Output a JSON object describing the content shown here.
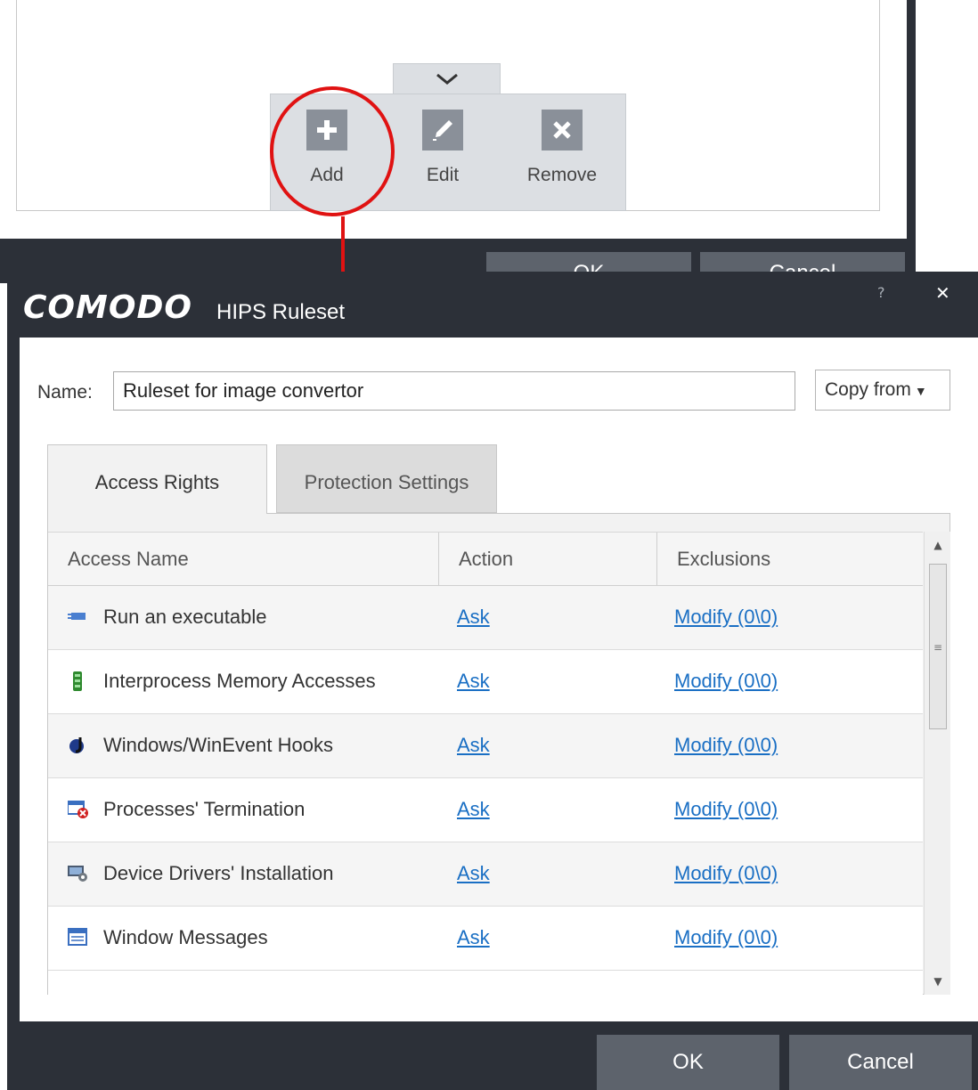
{
  "background_window": {
    "toolbar": {
      "add_label": "Add",
      "edit_label": "Edit",
      "remove_label": "Remove"
    },
    "ok_label": "OK",
    "cancel_label": "Cancel"
  },
  "dialog": {
    "brand": "COMODO",
    "title": "HIPS Ruleset",
    "help_glyph": "?",
    "close_glyph": "✕",
    "name_label": "Name:",
    "name_value": "Ruleset for image convertor",
    "copy_from_label": "Copy from",
    "tabs": [
      {
        "label": "Access Rights",
        "selected": true
      },
      {
        "label": "Protection Settings",
        "selected": false
      }
    ],
    "table": {
      "columns": [
        "Access Name",
        "Action",
        "Exclusions"
      ],
      "rows": [
        {
          "icon": "run-executable-icon",
          "name": "Run an executable",
          "action": "Ask",
          "exclusions": "Modify (0\\0)"
        },
        {
          "icon": "memory-access-icon",
          "name": "Interprocess Memory Accesses",
          "action": "Ask",
          "exclusions": "Modify (0\\0)"
        },
        {
          "icon": "hooks-icon",
          "name": "Windows/WinEvent Hooks",
          "action": "Ask",
          "exclusions": "Modify (0\\0)"
        },
        {
          "icon": "process-termination-icon",
          "name": "Processes' Termination",
          "action": "Ask",
          "exclusions": "Modify (0\\0)"
        },
        {
          "icon": "device-driver-icon",
          "name": "Device Drivers' Installation",
          "action": "Ask",
          "exclusions": "Modify (0\\0)"
        },
        {
          "icon": "window-messages-icon",
          "name": "Window Messages",
          "action": "Ask",
          "exclusions": "Modify (0\\0)"
        }
      ]
    },
    "ok_label": "OK",
    "cancel_label": "Cancel"
  },
  "colors": {
    "dark_chrome": "#2c3038",
    "button_bg": "#5d636c",
    "link": "#1a6fc4",
    "annotation_red": "#e01212"
  }
}
